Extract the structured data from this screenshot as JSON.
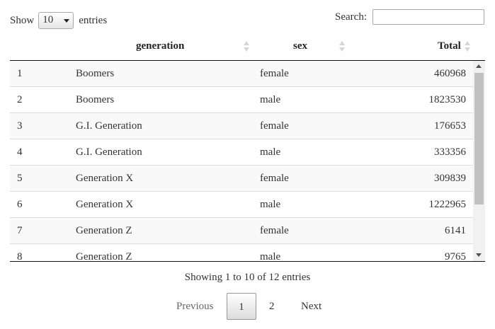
{
  "length_menu": {
    "prefix": "Show",
    "selected": "10",
    "suffix": "entries"
  },
  "search": {
    "label": "Search:",
    "value": ""
  },
  "columns": [
    {
      "label": ""
    },
    {
      "label": "generation"
    },
    {
      "label": "sex"
    },
    {
      "label": "Total"
    }
  ],
  "rows": [
    {
      "idx": "1",
      "generation": "Boomers",
      "sex": "female",
      "total": "460968"
    },
    {
      "idx": "2",
      "generation": "Boomers",
      "sex": "male",
      "total": "1823530"
    },
    {
      "idx": "3",
      "generation": "G.I. Generation",
      "sex": "female",
      "total": "176653"
    },
    {
      "idx": "4",
      "generation": "G.I. Generation",
      "sex": "male",
      "total": "333356"
    },
    {
      "idx": "5",
      "generation": "Generation X",
      "sex": "female",
      "total": "309839"
    },
    {
      "idx": "6",
      "generation": "Generation X",
      "sex": "male",
      "total": "1222965"
    },
    {
      "idx": "7",
      "generation": "Generation Z",
      "sex": "female",
      "total": "6141"
    },
    {
      "idx": "8",
      "generation": "Generation Z",
      "sex": "male",
      "total": "9765"
    }
  ],
  "info": "Showing 1 to 10 of 12 entries",
  "pagination": {
    "previous": "Previous",
    "pages": [
      "1",
      "2"
    ],
    "current": "1",
    "next": "Next"
  },
  "icons": {
    "sort": "sort-both-icon",
    "scroll_up": "scroll-up-arrow-icon",
    "scroll_down": "scroll-down-arrow-icon",
    "dropdown": "chevron-down-icon"
  }
}
